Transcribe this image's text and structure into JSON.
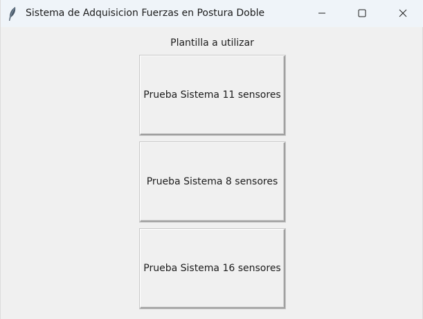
{
  "window": {
    "title": "Sistema de Adquisicion Fuerzas en Postura Doble",
    "app_icon": "feather-icon",
    "controls": [
      "minimize-icon",
      "maximize-icon",
      "close-icon"
    ]
  },
  "main": {
    "prompt_label": "Plantilla a utilizar",
    "buttons": [
      {
        "label": "Prueba Sistema 11 sensores"
      },
      {
        "label": "Prueba Sistema 8 sensores"
      },
      {
        "label": "Prueba Sistema 16 sensores"
      }
    ]
  },
  "colors": {
    "titlebar_bg": "#eff4f9",
    "window_bg": "#f0f0f0",
    "text": "#1b1b1b"
  }
}
